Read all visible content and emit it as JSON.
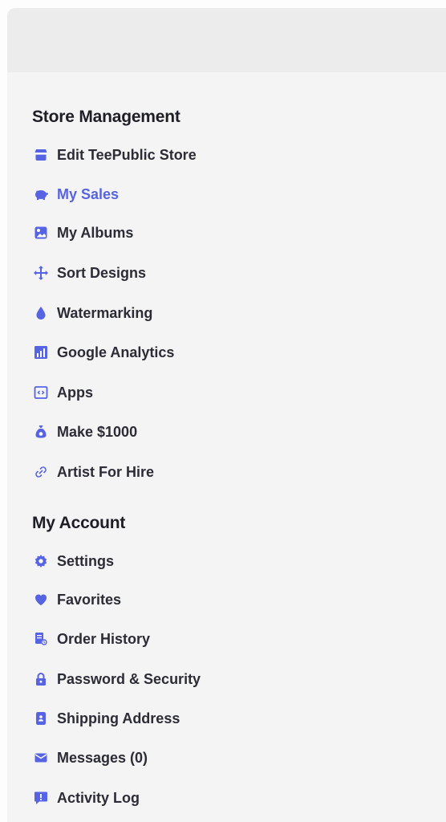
{
  "colors": {
    "accent": "#5663e3",
    "text": "#2b2c35",
    "heading": "#1d1e26",
    "header_bg": "#ececed",
    "panel_bg": "#f4f4f4"
  },
  "store_management": {
    "title": "Store Management",
    "items": [
      {
        "label": "Edit TeePublic Store",
        "icon": "store-icon",
        "active": false
      },
      {
        "label": "My Sales",
        "icon": "piggy-bank-icon",
        "active": true
      },
      {
        "label": "My Albums",
        "icon": "album-icon",
        "active": false
      },
      {
        "label": "Sort Designs",
        "icon": "move-arrows-icon",
        "active": false
      },
      {
        "label": "Watermarking",
        "icon": "droplet-icon",
        "active": false
      },
      {
        "label": "Google Analytics",
        "icon": "bar-chart-icon",
        "active": false
      },
      {
        "label": "Apps",
        "icon": "code-window-icon",
        "active": false
      },
      {
        "label": "Make $1000",
        "icon": "money-bag-icon",
        "active": false
      },
      {
        "label": "Artist For Hire",
        "icon": "link-icon",
        "active": false
      }
    ]
  },
  "my_account": {
    "title": "My Account",
    "items": [
      {
        "label": "Settings",
        "icon": "gear-icon"
      },
      {
        "label": "Favorites",
        "icon": "heart-icon"
      },
      {
        "label": "Order History",
        "icon": "receipt-icon"
      },
      {
        "label": "Password & Security",
        "icon": "lock-icon"
      },
      {
        "label": "Shipping Address",
        "icon": "address-card-icon"
      },
      {
        "label": "Messages (0)",
        "icon": "envelope-icon"
      },
      {
        "label": "Activity Log",
        "icon": "alert-comment-icon"
      }
    ]
  }
}
